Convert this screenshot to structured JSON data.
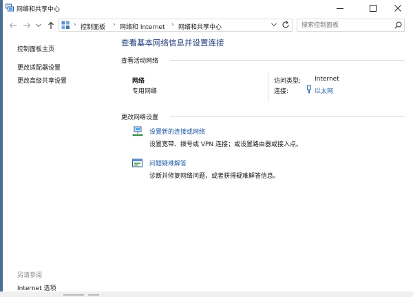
{
  "window": {
    "title": "网络和共享中心",
    "icon": "network-center-icon",
    "controls": [
      "minimize-icon",
      "maximize-icon",
      "close-icon"
    ]
  },
  "navigation": {
    "back_icon": "back-arrow-icon",
    "forward_icon": "forward-arrow-icon",
    "recent_icon": "chevron-down-icon",
    "up_icon": "up-arrow-icon",
    "breadcrumb": [
      "控制面板",
      "网络和 Internet",
      "网络和共享中心"
    ],
    "refresh_icon": "refresh-icon",
    "search_placeholder": "搜索控制面板",
    "search_icon": "search-icon"
  },
  "sidebar": {
    "home": "控制面板主页",
    "items": [
      "更改适配器设置",
      "更改高级共享设置"
    ],
    "see_also_title": "另请参阅",
    "see_also_items": [
      "Internet 选项"
    ]
  },
  "main": {
    "title": "查看基本网络信息并设置连接",
    "active_networks": {
      "header": "查看活动网络",
      "network_name": "网络",
      "network_profile": "专用网络",
      "access_type_label": "访问类型:",
      "access_type_value": "Internet",
      "connections_label": "连接:",
      "connection_value": "以太网"
    },
    "change_settings": {
      "header": "更改网络设置",
      "tasks": [
        {
          "icon": "new-connection-icon",
          "link": "设置新的连接或网络",
          "desc": "设置宽带、拨号或 VPN 连接；或设置路由器或接入点。"
        },
        {
          "icon": "troubleshoot-icon",
          "link": "问题疑难解答",
          "desc": "诊断并修复网络问题，或者获得疑难解答信息。"
        }
      ]
    }
  },
  "colors": {
    "title_link": "#1e3a78",
    "link": "#1f5aa0",
    "taskbar_edge": "#4a6f95"
  }
}
